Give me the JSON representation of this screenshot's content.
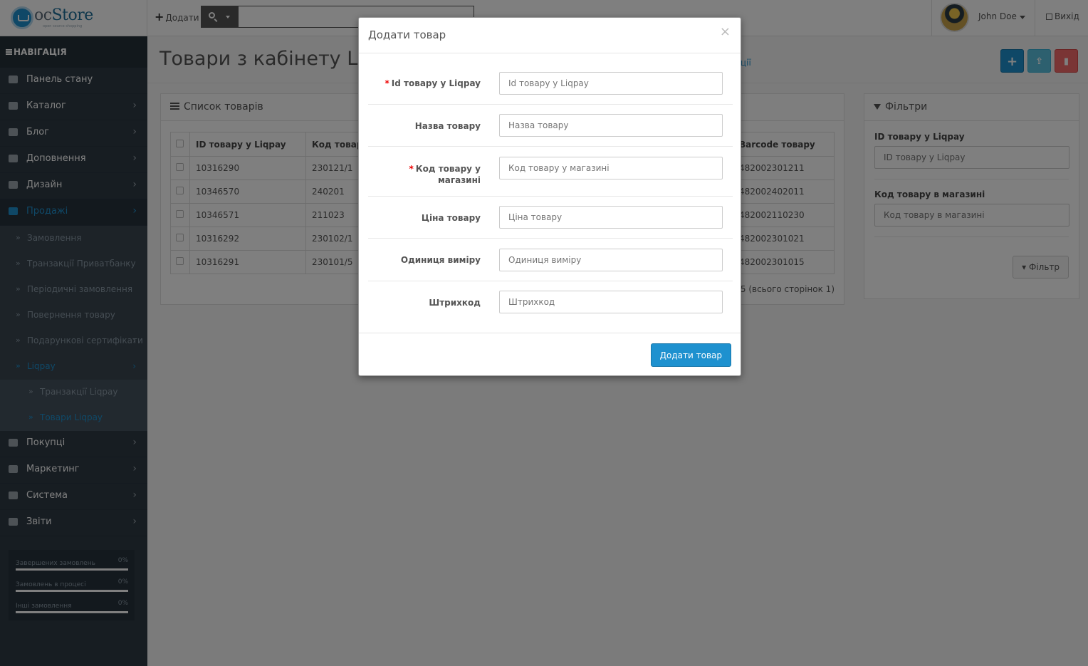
{
  "header": {
    "logo_text_1": "oc",
    "logo_text_2": "Store",
    "logo_tagline": "open source shopping",
    "add_label": "Додати",
    "search_placeholder": "",
    "user_name": "John Doe",
    "logout_label": "Вихід"
  },
  "sidebar": {
    "heading": "НАВІГАЦІЯ",
    "items": [
      {
        "label": "Панель стану",
        "icon": "dashboard-icon"
      },
      {
        "label": "Каталог",
        "icon": "tags-icon"
      },
      {
        "label": "Блог",
        "icon": "book-icon"
      },
      {
        "label": "Доповнення",
        "icon": "puzzle-icon"
      },
      {
        "label": "Дизайн",
        "icon": "monitor-icon"
      },
      {
        "label": "Продажі",
        "icon": "cart-icon"
      }
    ],
    "sales_sub": [
      {
        "label": "Замовлення"
      },
      {
        "label": "Транзакції Приватбанку"
      },
      {
        "label": "Періодичні замовлення"
      },
      {
        "label": "Повернення товару"
      },
      {
        "label": "Подарункові сертифікати"
      },
      {
        "label": "Liqpay"
      }
    ],
    "liqpay_sub": [
      {
        "label": "Транзакції Liqpay"
      },
      {
        "label": "Товари Liqpay"
      }
    ],
    "items_after": [
      {
        "label": "Покупці",
        "icon": "user-icon"
      },
      {
        "label": "Маркетинг",
        "icon": "share-icon"
      },
      {
        "label": "Система",
        "icon": "cog-icon"
      },
      {
        "label": "Звіти",
        "icon": "bar-chart-icon"
      }
    ],
    "stats": [
      {
        "label": "Завершених замовлень",
        "value": "0%",
        "fraction": 0
      },
      {
        "label": "Замовлень в процесі",
        "value": "0%",
        "fraction": 0
      },
      {
        "label": "Інші замовлення",
        "value": "0%",
        "fraction": 0
      }
    ]
  },
  "page": {
    "title": "Товари з кабінету Liqpay",
    "breadcrumb_tail": "ції"
  },
  "list_panel": {
    "heading": "Список товарів",
    "columns": [
      "ID товару у Liqpay",
      "Код товару",
      "Barcode товару"
    ],
    "rows": [
      {
        "id": "10316290",
        "code": "230121/1",
        "barcode": "4820023012111"
      },
      {
        "id": "10346570",
        "code": "240201",
        "barcode": "4820024020111"
      },
      {
        "id": "10346571",
        "code": "211023",
        "barcode": "4820021102301"
      },
      {
        "id": "10316292",
        "code": "230102/1",
        "barcode": "4820023010211"
      },
      {
        "id": "10316291",
        "code": "230101/5",
        "barcode": "4820023010151"
      }
    ],
    "rows_visible_barcode": [
      "482002301211",
      "482002402011",
      "482002110230",
      "482002301021",
      "482002301015"
    ],
    "pager": "з 1 по 5 із 5 (всього сторінок 1)",
    "pager_visible": "із 5 (всього сторінок 1)"
  },
  "filter_panel": {
    "heading": "Фільтри",
    "field1_label": "ID товару у Liqpay",
    "field1_placeholder": "ID товару у Liqpay",
    "field2_label": "Код товару в магазині",
    "field2_placeholder": "Код товару в магазині",
    "button": "Фільтр"
  },
  "modal": {
    "title": "Додати товар",
    "close": "×",
    "fields": [
      {
        "label": "Id товару у Liqpay",
        "placeholder": "Id товару у Liqpay",
        "required": true
      },
      {
        "label": "Назва товару",
        "placeholder": "Назва товару",
        "required": false
      },
      {
        "label": "Код товару у магазині",
        "placeholder": "Код товару у магазині",
        "required": true
      },
      {
        "label": "Ціна товару",
        "placeholder": "Ціна товару",
        "required": false
      },
      {
        "label": "Одиниця виміру",
        "placeholder": "Одиниця виміру",
        "required": false
      },
      {
        "label": "Штрихкод",
        "placeholder": "Штрихкод",
        "required": false
      }
    ],
    "submit": "Додати товар"
  },
  "colors": {
    "primary": "#1e91cf",
    "sidebar_bg": "#2e3a45",
    "danger": "#f56b6b",
    "info": "#5bc0de"
  }
}
